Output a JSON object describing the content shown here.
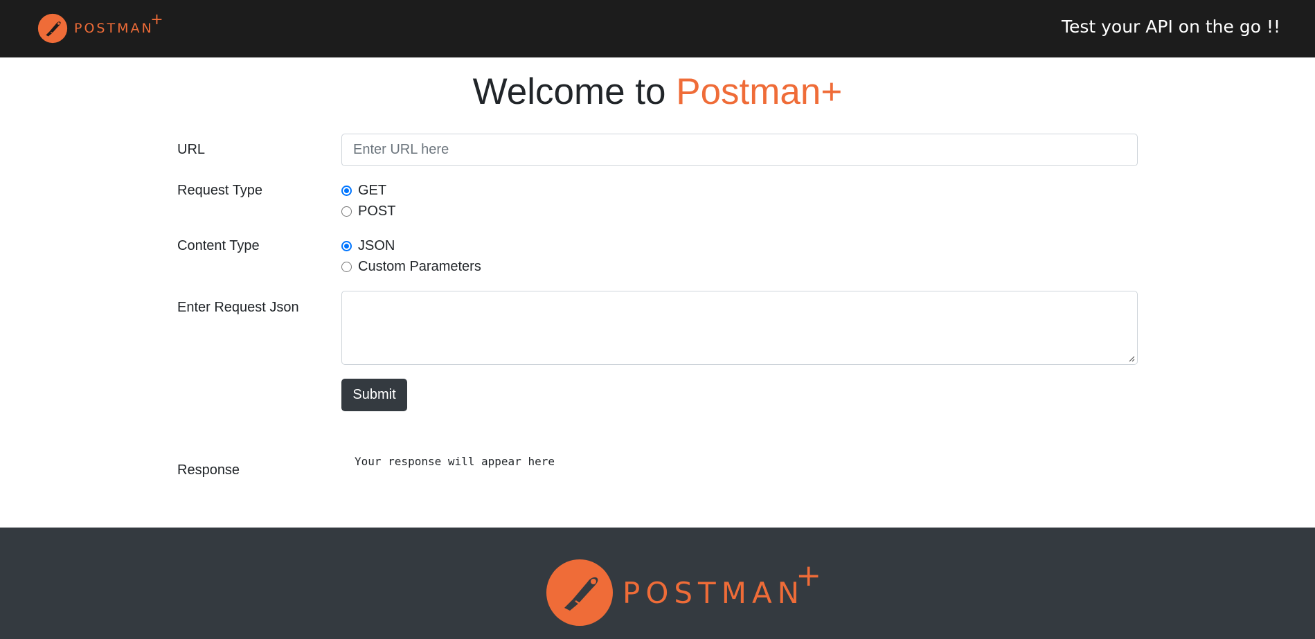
{
  "navbar": {
    "brand_text": "POSTMAN",
    "brand_plus": "+",
    "logo_icon": "postman-rocket-icon",
    "tagline": "Test your API on the go !!"
  },
  "heading": {
    "prefix": "Welcome to ",
    "accent": "Postman+"
  },
  "form": {
    "url_label": "URL",
    "url_placeholder": "Enter URL here",
    "url_value": "",
    "request_type_label": "Request Type",
    "request_type_options": [
      "GET",
      "POST"
    ],
    "request_type_selected": "GET",
    "content_type_label": "Content Type",
    "content_type_options": [
      "JSON",
      "Custom Parameters"
    ],
    "content_type_selected": "JSON",
    "request_json_label": "Enter Request Json",
    "request_json_value": "",
    "submit_label": "Submit"
  },
  "response": {
    "label": "Response",
    "text": "Your response will appear here"
  },
  "footer": {
    "brand_text": "POSTMAN",
    "brand_plus": "+"
  },
  "colors": {
    "accent": "#ef6c38",
    "navbar_bg": "#1c1c1c",
    "footer_bg": "#343a40",
    "radio_checked": "#0075ff"
  }
}
